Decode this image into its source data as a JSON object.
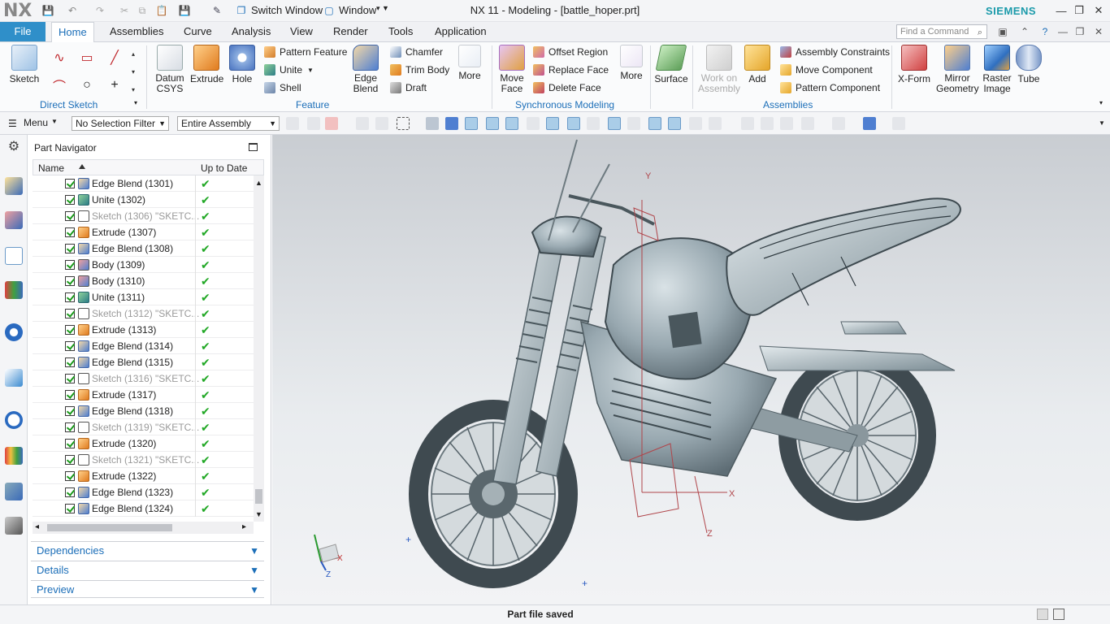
{
  "window": {
    "app_logo": "NX",
    "title": "NX 11 - Modeling - [battle_hoper.prt]",
    "brand": "SIEMENS",
    "quick_access": {
      "switch_window": "Switch Window",
      "window_menu": "Window"
    }
  },
  "menu_tabs": {
    "file": "File",
    "home": "Home",
    "assemblies": "Assemblies",
    "curve": "Curve",
    "analysis": "Analysis",
    "view": "View",
    "render": "Render",
    "tools": "Tools",
    "application": "Application"
  },
  "find_command": {
    "placeholder": "Find a Command"
  },
  "ribbon": {
    "direct_sketch": {
      "label": "Direct Sketch",
      "sketch": "Sketch"
    },
    "feature": {
      "label": "Feature",
      "datum_csys": "Datum CSYS",
      "extrude": "Extrude",
      "hole": "Hole",
      "pattern_feature": "Pattern Feature",
      "unite": "Unite",
      "shell": "Shell",
      "edge_blend": "Edge Blend",
      "chamfer": "Chamfer",
      "trim_body": "Trim Body",
      "draft": "Draft",
      "more": "More"
    },
    "synchronous": {
      "label": "Synchronous Modeling",
      "move_face": "Move Face",
      "offset_region": "Offset Region",
      "replace_face": "Replace Face",
      "delete_face": "Delete Face",
      "more": "More"
    },
    "surface": {
      "label": "Surface"
    },
    "assemblies": {
      "label": "Assemblies",
      "work_on_assembly": "Work on Assembly",
      "add": "Add",
      "assembly_constraints": "Assembly Constraints",
      "move_component": "Move Component",
      "pattern_component": "Pattern Component"
    },
    "extra": {
      "xform": "X-Form",
      "mirror_geometry": "Mirror Geometry",
      "raster_image": "Raster Image",
      "tube": "Tube"
    }
  },
  "toolbar": {
    "menu": "Menu",
    "selection_filter": "No Selection Filter",
    "scope": "Entire Assembly"
  },
  "navigator": {
    "title": "Part Navigator",
    "columns": {
      "name": "Name",
      "up_to_date": "Up to Date"
    },
    "rows": [
      {
        "label": "Edge Blend (1301)",
        "type": "blend",
        "status": "✔"
      },
      {
        "label": "Unite (1302)",
        "type": "unite",
        "status": "✔"
      },
      {
        "label": "Sketch (1306) \"SKETC...",
        "type": "sketch",
        "status": "✔"
      },
      {
        "label": "Extrude (1307)",
        "type": "extrude",
        "status": "✔"
      },
      {
        "label": "Edge Blend (1308)",
        "type": "blend",
        "status": "✔"
      },
      {
        "label": "Body (1309)",
        "type": "body",
        "status": "✔"
      },
      {
        "label": "Body (1310)",
        "type": "body",
        "status": "✔"
      },
      {
        "label": "Unite (1311)",
        "type": "unite",
        "status": "✔"
      },
      {
        "label": "Sketch (1312) \"SKETC...",
        "type": "sketch",
        "status": "✔"
      },
      {
        "label": "Extrude (1313)",
        "type": "extrude",
        "status": "✔"
      },
      {
        "label": "Edge Blend (1314)",
        "type": "blend",
        "status": "✔"
      },
      {
        "label": "Edge Blend (1315)",
        "type": "blend",
        "status": "✔"
      },
      {
        "label": "Sketch (1316) \"SKETC...",
        "type": "sketch",
        "status": "✔"
      },
      {
        "label": "Extrude (1317)",
        "type": "extrude",
        "status": "✔"
      },
      {
        "label": "Edge Blend (1318)",
        "type": "blend",
        "status": "✔"
      },
      {
        "label": "Sketch (1319) \"SKETC...",
        "type": "sketch",
        "status": "✔"
      },
      {
        "label": "Extrude (1320)",
        "type": "extrude",
        "status": "✔"
      },
      {
        "label": "Sketch (1321) \"SKETC...",
        "type": "sketch",
        "status": "✔"
      },
      {
        "label": "Extrude (1322)",
        "type": "extrude",
        "status": "✔"
      },
      {
        "label": "Edge Blend (1323)",
        "type": "blend",
        "status": "✔"
      },
      {
        "label": "Edge Blend (1324)",
        "type": "blend",
        "status": "✔"
      }
    ],
    "panels": {
      "dependencies": "Dependencies",
      "details": "Details",
      "preview": "Preview"
    }
  },
  "viewport": {
    "axis_labels": {
      "x": "X",
      "y": "Y",
      "z": "Z"
    },
    "triad_labels": {
      "x": "X",
      "y": "Y",
      "z": "Z"
    }
  },
  "status": {
    "message": "Part file saved"
  },
  "colors": {
    "accent": "#2f8fc9",
    "link_blue": "#1b6eb8",
    "brand": "#1a9aaa",
    "check_green": "#21a825"
  }
}
